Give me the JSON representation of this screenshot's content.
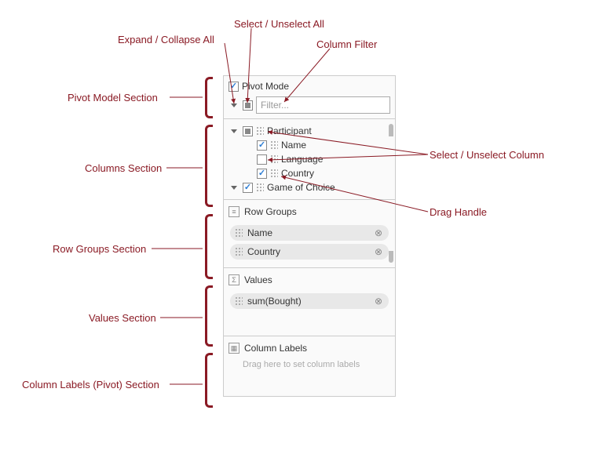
{
  "colors": {
    "accent": "#2b7cd3",
    "anno": "#8a1a24"
  },
  "pivot": {
    "label": "Pivot Mode",
    "checked": true
  },
  "toolbar": {
    "filter_placeholder": "Filter..."
  },
  "columns": {
    "groups": [
      {
        "name": "Participant",
        "expanded": true,
        "state": "indeterminate",
        "children": [
          {
            "name": "Name",
            "checked": true
          },
          {
            "name": "Language",
            "checked": false
          },
          {
            "name": "Country",
            "checked": true
          }
        ]
      },
      {
        "name": "Game of Choice",
        "expanded": true,
        "state": "checked",
        "children": []
      }
    ]
  },
  "rowGroups": {
    "title": "Row Groups",
    "items": [
      {
        "label": "Name"
      },
      {
        "label": "Country"
      }
    ]
  },
  "values": {
    "title": "Values",
    "items": [
      {
        "label": "sum(Bought)"
      }
    ]
  },
  "columnLabels": {
    "title": "Column Labels",
    "hint": "Drag here to set column labels"
  },
  "annos": {
    "pivotSection": "Pivot Model Section",
    "columnsSection": "Columns Section",
    "rowGroupsSection": "Row Groups Section",
    "valuesSection": "Values Section",
    "columnLabelsSection": "Column Labels (Pivot) Section",
    "expandCollapse": "Expand / Collapse All",
    "selectAll": "Select / Unselect All",
    "columnFilter": "Column Filter",
    "selectColumn": "Select / Unselect Column",
    "dragHandle": "Drag Handle"
  }
}
